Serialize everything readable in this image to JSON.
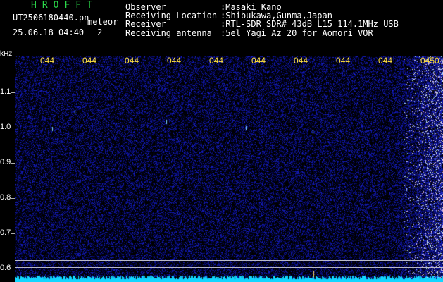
{
  "header": {
    "brand": "HROFFT",
    "file_name": "UT2506180440.pn",
    "tag": "meteor",
    "timestamp": "25.06.18 04:40",
    "count": "2_"
  },
  "info": [
    {
      "key": "Observer",
      "value": ":Masaki Kano"
    },
    {
      "key": "Receiving Location",
      "value": ":Shibukawa,Gunma,Japan"
    },
    {
      "key": "Receiver",
      "value": ":RTL-SDR SDR# 43dB L15 114.1MHz USB"
    },
    {
      "key": "Receiving antenna",
      "value": ":5el Yagi Az 20 for Aomori VOR"
    }
  ],
  "y_axis": {
    "label": "kHz",
    "ticks": [
      "1.1",
      "1.0",
      "0.9",
      "0.8",
      "0.7",
      "0.6"
    ]
  },
  "x_axis": {
    "ticks": [
      "044",
      "044",
      "044",
      "044",
      "044",
      "044",
      "044",
      "044",
      "044",
      "0450"
    ]
  },
  "colors": {
    "background": "#000000",
    "signal": "#1a2bd6",
    "highlight": "#00e5ff",
    "brand": "#2bd94a",
    "tick_text": "#ffe040"
  }
}
